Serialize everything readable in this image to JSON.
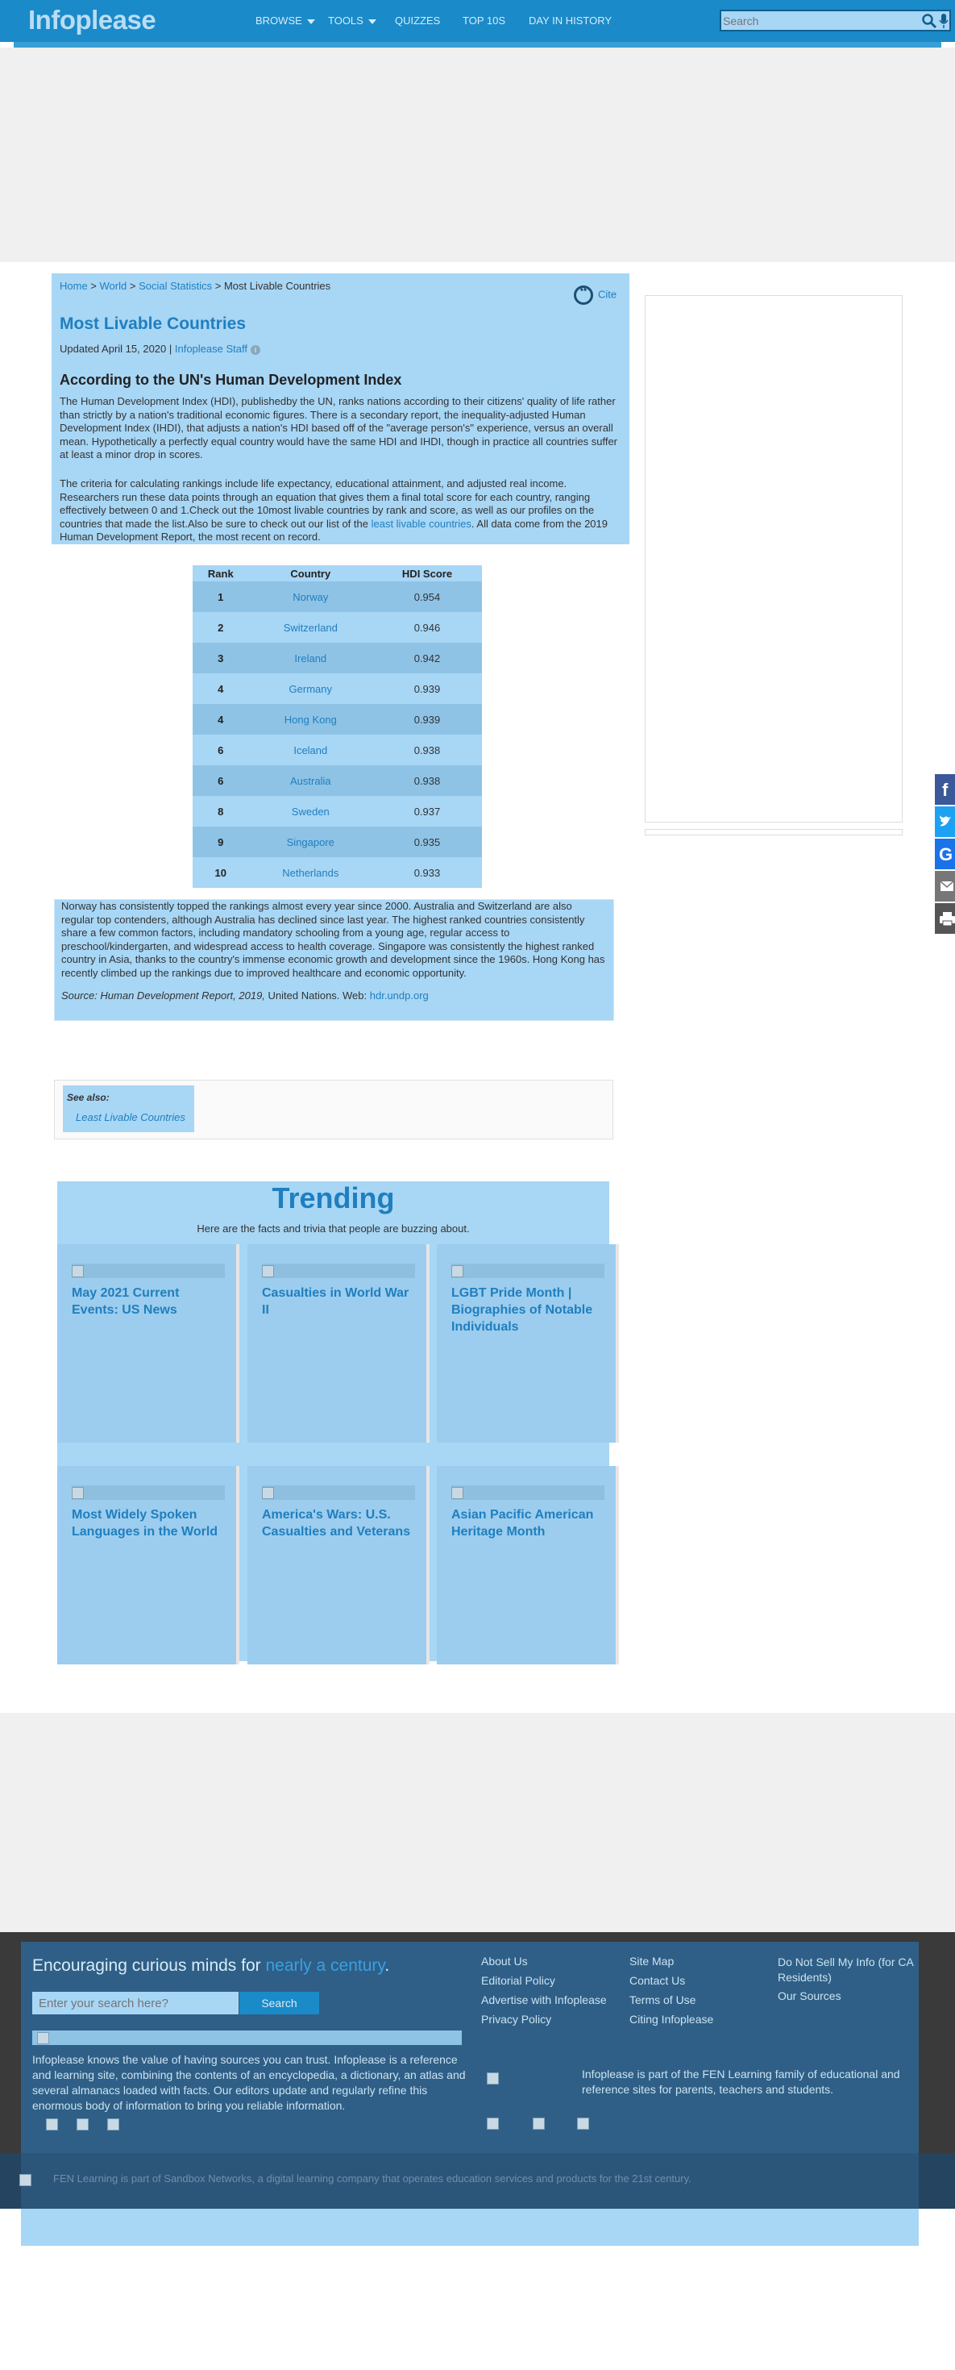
{
  "header": {
    "logo": "Infoplease",
    "nav": [
      "BROWSE",
      "TOOLS",
      "QUIZZES",
      "TOP 10S",
      "DAY IN HISTORY"
    ],
    "search_placeholder": "Search"
  },
  "breadcrumb": [
    "Home",
    "World",
    "Social Statistics",
    "Most Livable Countries"
  ],
  "cite_label": "Cite",
  "page_title": "Most Livable Countries",
  "updated_prefix": "Updated April 15, 2020 | ",
  "updated_author": "Infoplease Staff",
  "subtitle": "According to the UN's Human Development Index",
  "para1": "The Human Development Index (HDI), publishedby the UN, ranks nations according to their citizens' quality of life rather than strictly by a nation's traditional economic figures. There is a secondary report, the inequality-adjusted Human Development Index (IHDI), that adjusts a nation's HDI based off of the \"average person's\" experience, versus an overall mean. Hypothetically a perfectly equal country would have the same HDI and IHDI, though in practice all countries suffer at least a minor drop in scores.",
  "para2_a": "The criteria for calculating rankings include life expectancy, educational attainment, and adjusted real income. Researchers run these data points through an equation that gives them a final total score for each country, ranging effectively between 0 and 1.Check out the 10most livable countries by rank and score, as well as our profiles on the countries that made the list.Also be sure to check out our list of the ",
  "para2_link": "least livable countries",
  "para2_b": ". All data come from the 2019 Human Development Report, the most recent on record.",
  "table": {
    "headers": [
      "Rank",
      "Country",
      "HDI Score"
    ],
    "rows": [
      {
        "rank": "1",
        "country": "Norway",
        "score": "0.954"
      },
      {
        "rank": "2",
        "country": "Switzerland",
        "score": "0.946"
      },
      {
        "rank": "3",
        "country": "Ireland",
        "score": "0.942"
      },
      {
        "rank": "4",
        "country": "Germany",
        "score": "0.939"
      },
      {
        "rank": "4",
        "country": "Hong Kong",
        "score": "0.939"
      },
      {
        "rank": "6",
        "country": "Iceland",
        "score": "0.938"
      },
      {
        "rank": "6",
        "country": "Australia",
        "score": "0.938"
      },
      {
        "rank": "8",
        "country": "Sweden",
        "score": "0.937"
      },
      {
        "rank": "9",
        "country": "Singapore",
        "score": "0.935"
      },
      {
        "rank": "10",
        "country": "Netherlands",
        "score": "0.933"
      }
    ]
  },
  "note": "Norway has consistently topped the rankings almost every year since 2000. Australia and Switzerland are also regular top contenders, although Australia has declined since last year. The highest ranked countries consistently share a few common factors, including mandatory schooling from a young age, regular access to preschool/kindergarten, and widespread access to health coverage. Singapore was consistently the highest ranked country in Asia, thanks to the country's immense economic growth and development since the 1960s. Hong Kong has recently climbed up the rankings due to improved healthcare and economic opportunity.",
  "source_prefix": "Source: Human Development Report, 2019,",
  "source_mid": " United Nations. Web: ",
  "source_link": "hdr.undp.org",
  "see_also": {
    "label": "See also:",
    "link": "Least Livable Countries"
  },
  "trending": {
    "title": "Trending",
    "subtitle": "Here are the facts and trivia that people are buzzing about.",
    "cards": [
      "May 2021 Current Events: US News",
      "Casualties in World War II",
      "LGBT Pride Month | Biographies of Notable Individuals",
      "Most Widely Spoken Languages in the World",
      "America's Wars: U.S. Casualties and Veterans",
      "Asian Pacific American Heritage Month"
    ]
  },
  "share_icons": [
    "facebook-icon",
    "twitter-icon",
    "google-icon",
    "email-icon",
    "print-icon"
  ],
  "footer": {
    "tagline": "Encouraging curious minds for ",
    "tagline_highlight": "nearly a century",
    "tagline_end": ".",
    "search_placeholder": "Enter your search here?",
    "search_button": "Search",
    "about": "Infoplease knows the value of having sources you can trust. Infoplease is a reference and learning site, combining the contents of an encyclopedia, a dictionary, an atlas and several almanacs loaded with facts. Our editors update and regularly refine this enormous body of information to bring you reliable information.",
    "col1": [
      "About Us",
      "Editorial Policy",
      "Advertise with Infoplease",
      "Privacy Policy"
    ],
    "col2": [
      "Site Map",
      "Contact Us",
      "Terms of Use",
      "Citing Infoplease"
    ],
    "col3": [
      "Do Not Sell My Info (for CA Residents)",
      "Our Sources"
    ],
    "fen": "Infoplease is part of the FEN Learning family of educational and reference sites for parents, teachers and students.",
    "sandbox": "FEN Learning is part of Sandbox Networks, a digital learning company that operates education services and products for the 21st century."
  },
  "colors": {
    "header_bg": "#1a8ac9",
    "panel_bg": "#a8d6f5",
    "link": "#1f7fbf",
    "footer_bg": "#2f5f86"
  }
}
